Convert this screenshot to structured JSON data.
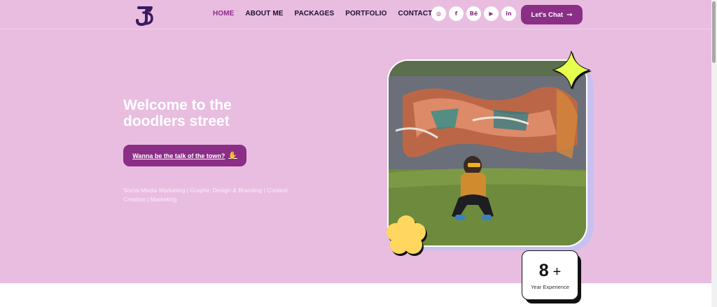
{
  "header": {
    "logo_name": "ts-monogram-logo",
    "nav": [
      {
        "label": "HOME",
        "active": true
      },
      {
        "label": "ABOUT ME",
        "active": false
      },
      {
        "label": "PACKAGES",
        "active": false
      },
      {
        "label": "PORTFOLIO",
        "active": false
      },
      {
        "label": "CONTACT",
        "active": false
      }
    ],
    "socials": [
      {
        "icon": "instagram-icon",
        "glyph": "◎"
      },
      {
        "icon": "facebook-icon",
        "glyph": "f"
      },
      {
        "icon": "behance-icon",
        "glyph": "Bē"
      },
      {
        "icon": "youtube-icon",
        "glyph": "▶"
      },
      {
        "icon": "linkedin-icon",
        "glyph": "in"
      }
    ],
    "chat_label": "Let's Chat",
    "chat_arrow": "→"
  },
  "hero": {
    "title_line1": "Welcome to the",
    "title_line2": "doodlers street",
    "cta_label": "Wanna be the talk of the town?",
    "cta_icon": "✋",
    "services": "Social Media Marketing | Graphic Design & Branding | Content Creation | Marketing"
  },
  "experience": {
    "number": "8",
    "plus": "+",
    "label": "Year Experience"
  },
  "colors": {
    "brand": "#8b2e86",
    "hero_bg": "#e8bde0",
    "sparkle": "#e6ff4f",
    "flower": "#ffd75e",
    "photo_shadow": "#c7c1ef"
  }
}
